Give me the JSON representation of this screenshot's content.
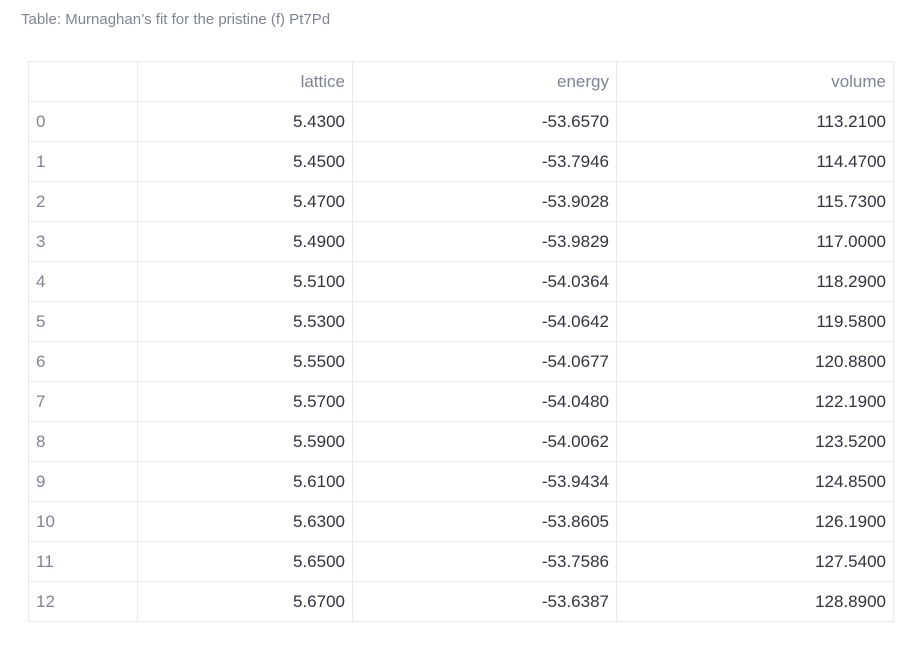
{
  "caption": "Table: Murnaghan’s fit for the pristine (f) Pt7Pd",
  "table": {
    "index_header": "",
    "columns": [
      "lattice",
      "energy",
      "volume"
    ],
    "rows": [
      {
        "index": "0",
        "lattice": "5.4300",
        "energy": "-53.6570",
        "volume": "113.2100"
      },
      {
        "index": "1",
        "lattice": "5.4500",
        "energy": "-53.7946",
        "volume": "114.4700"
      },
      {
        "index": "2",
        "lattice": "5.4700",
        "energy": "-53.9028",
        "volume": "115.7300"
      },
      {
        "index": "3",
        "lattice": "5.4900",
        "energy": "-53.9829",
        "volume": "117.0000"
      },
      {
        "index": "4",
        "lattice": "5.5100",
        "energy": "-54.0364",
        "volume": "118.2900"
      },
      {
        "index": "5",
        "lattice": "5.5300",
        "energy": "-54.0642",
        "volume": "119.5800"
      },
      {
        "index": "6",
        "lattice": "5.5500",
        "energy": "-54.0677",
        "volume": "120.8800"
      },
      {
        "index": "7",
        "lattice": "5.5700",
        "energy": "-54.0480",
        "volume": "122.1900"
      },
      {
        "index": "8",
        "lattice": "5.5900",
        "energy": "-54.0062",
        "volume": "123.5200"
      },
      {
        "index": "9",
        "lattice": "5.6100",
        "energy": "-53.9434",
        "volume": "124.8500"
      },
      {
        "index": "10",
        "lattice": "5.6300",
        "energy": "-53.8605",
        "volume": "126.1900"
      },
      {
        "index": "11",
        "lattice": "5.6500",
        "energy": "-53.7586",
        "volume": "127.5400"
      },
      {
        "index": "12",
        "lattice": "5.6700",
        "energy": "-53.6387",
        "volume": "128.8900"
      }
    ]
  },
  "colors": {
    "text": "#31333f",
    "muted": "#808495",
    "border": "#e6e9ef"
  }
}
